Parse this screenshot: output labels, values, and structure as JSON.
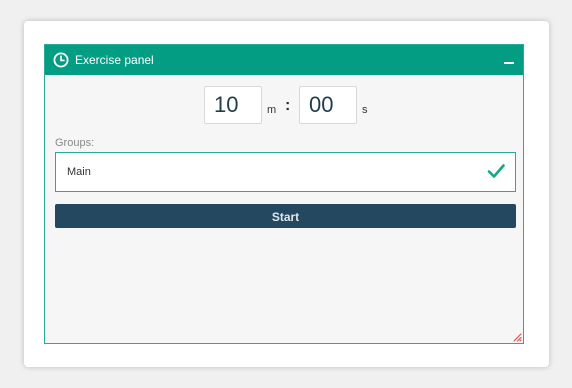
{
  "panel": {
    "title": "Exercise panel",
    "header_color": "#039d84",
    "border_color": "#2aa89a"
  },
  "timer": {
    "minutes": "10",
    "minutes_unit": "m",
    "separator": ":",
    "seconds": "00",
    "seconds_unit": "s"
  },
  "groups": {
    "label": "Groups:",
    "selected": "Main",
    "status_icon": "check-icon",
    "status_color": "#13a884"
  },
  "actions": {
    "start_label": "Start",
    "start_color": "#244860"
  },
  "icons": {
    "header": "clock-icon",
    "collapse": "minimize-icon",
    "resize": "resize-grip-icon"
  }
}
